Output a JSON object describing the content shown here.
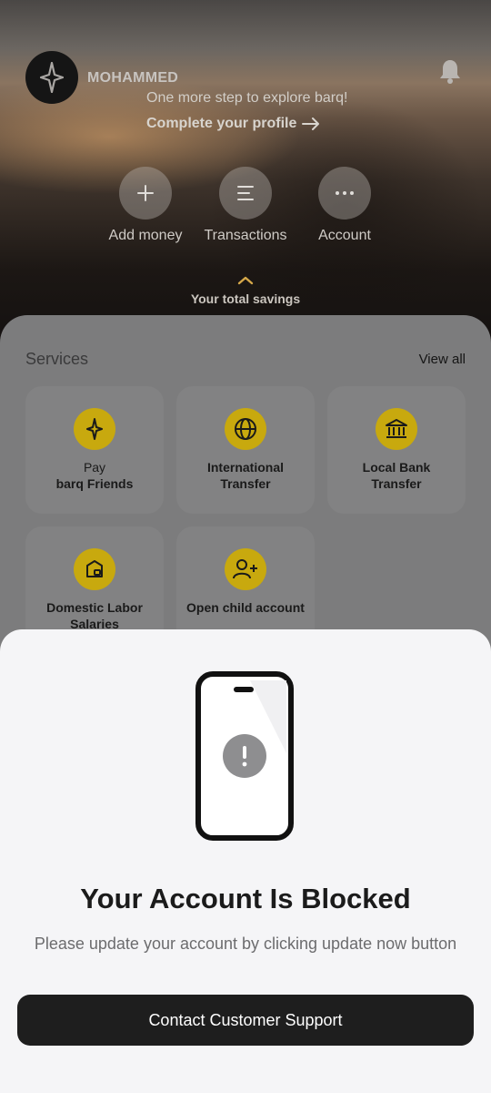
{
  "header": {
    "user_name": "MOHAMMED",
    "prompt": "One more step to explore barq!",
    "complete_profile": "Complete your profile"
  },
  "actions": [
    {
      "label": "Add money",
      "icon": "plus-icon"
    },
    {
      "label": "Transactions",
      "icon": "list-icon"
    },
    {
      "label": "Account",
      "icon": "more-icon"
    }
  ],
  "savings_label": "Your total savings",
  "services": {
    "title": "Services",
    "view_all": "View all",
    "items": [
      {
        "line1": "Pay",
        "line2": "barq Friends",
        "icon": "barq-icon"
      },
      {
        "line1": "International",
        "line2": "Transfer",
        "icon": "globe-icon"
      },
      {
        "line1": "Local Bank",
        "line2": "Transfer",
        "icon": "bank-icon"
      },
      {
        "line1": "Domestic Labor",
        "line2": "Salaries",
        "icon": "wallet-icon"
      },
      {
        "line1": "Open child account",
        "line2": "",
        "icon": "add-user-icon"
      }
    ]
  },
  "dialog": {
    "title": "Your Account Is Blocked",
    "message": "Please update your account by clicking update now button",
    "button": "Contact Customer Support"
  },
  "colors": {
    "accent_yellow": "#c8a90e",
    "button_dark": "#1e1e1e",
    "sheet_bg": "#f5f5f7"
  }
}
